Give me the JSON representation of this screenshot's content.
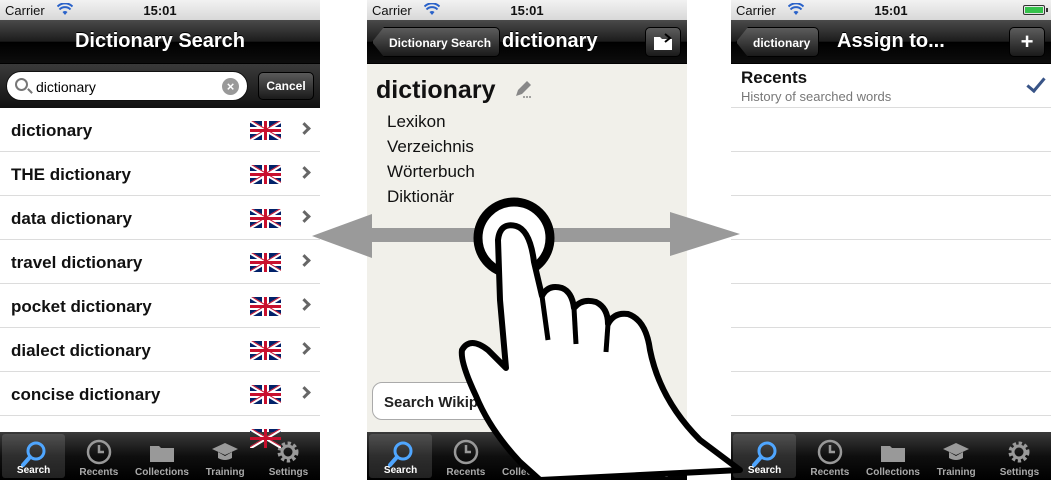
{
  "status": {
    "carrier": "Carrier",
    "time": "15:01"
  },
  "screen1": {
    "title": "Dictionary Search",
    "search": {
      "value": "dictionary",
      "cancel": "Cancel"
    },
    "results": [
      "dictionary",
      "THE dictionary",
      "data dictionary",
      "travel dictionary",
      "pocket dictionary",
      "dialect dictionary",
      "concise dictionary"
    ],
    "flag_icon": "uk-flag-icon"
  },
  "screen2": {
    "back": "Dictionary Search",
    "title": "dictionary",
    "headword": "dictionary",
    "translations": [
      "Lexikon",
      "Verzeichnis",
      "Wörterbuch",
      "Diktionär"
    ],
    "wiki_button": "Search Wikipedia"
  },
  "screen3": {
    "back": "dictionary",
    "title": "Assign to...",
    "add": "+",
    "recents": {
      "title": "Recents",
      "subtitle": "History of searched words"
    }
  },
  "tabs": [
    "Search",
    "Recents",
    "Collections",
    "Training",
    "Settings"
  ],
  "colors": {
    "accent": "#385487",
    "flag_blue": "#012169",
    "flag_red": "#c8102e"
  }
}
